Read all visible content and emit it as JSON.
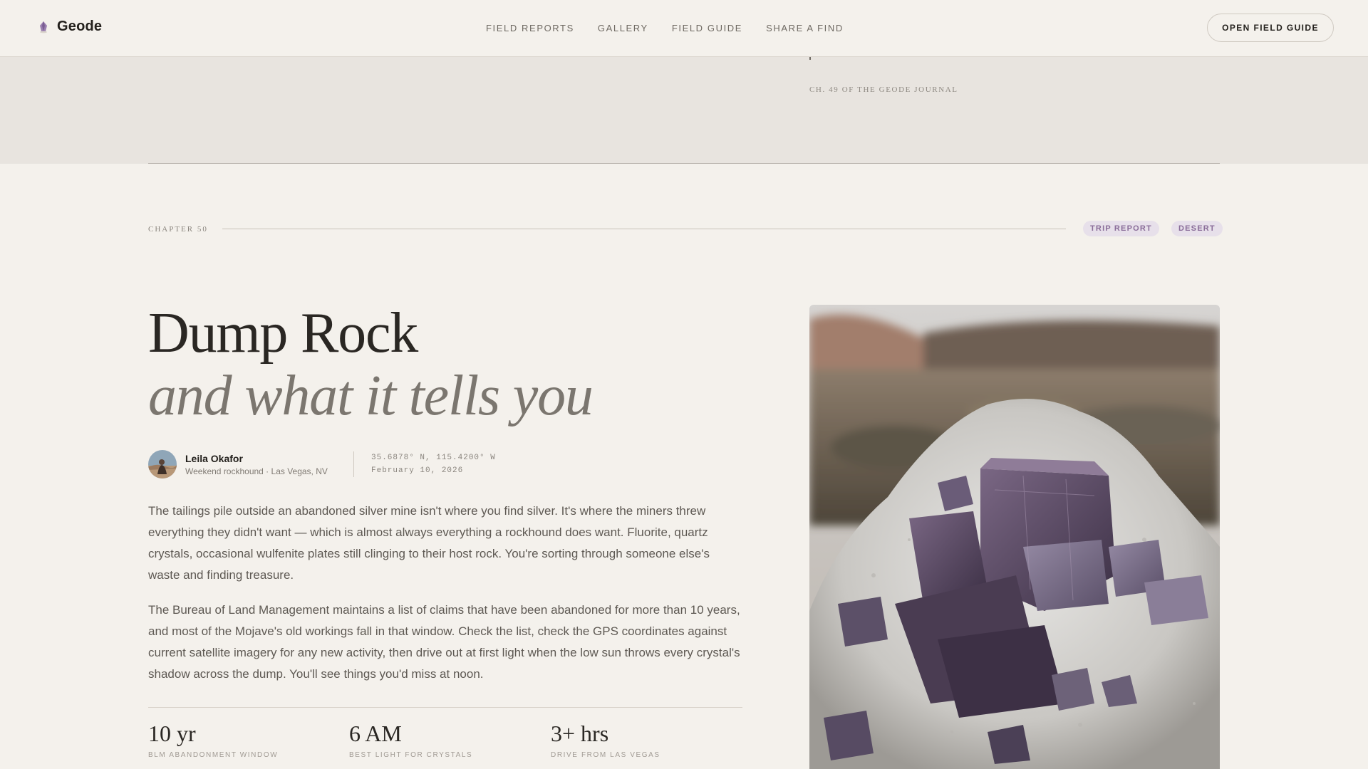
{
  "nav": {
    "brand": "Geode",
    "links": [
      "FIELD REPORTS",
      "GALLERY",
      "FIELD GUIDE",
      "SHARE A FIND"
    ],
    "cta": "OPEN FIELD GUIDE"
  },
  "previous": {
    "note": "CH. 49 OF THE GEODE JOURNAL"
  },
  "chapter": {
    "label": "CHAPTER 50",
    "tags": [
      "TRIP REPORT",
      "DESERT"
    ]
  },
  "headline": {
    "title": "Dump Rock",
    "subtitle": "and what it tells you"
  },
  "byline": {
    "author": "Leila Okafor",
    "role": "Weekend rockhound · Las Vegas, NV",
    "coordinates": "35.6878° N, 115.4200° W",
    "date": "February 10, 2026"
  },
  "body": {
    "paragraphs": [
      "The tailings pile outside an abandoned silver mine isn't where you find silver. It's where the miners threw everything they didn't want — which is almost always everything a rockhound does want. Fluorite, quartz crystals, occasional wulfenite plates still clinging to their host rock. You're sorting through someone else's waste and finding treasure.",
      "The Bureau of Land Management maintains a list of claims that have been abandoned for more than 10 years, and most of the Mojave's old workings fall in that window. Check the list, check the GPS coordinates against current satellite imagery for any new activity, then drive out at first light when the low sun throws every crystal's shadow across the dump. You'll see things you'd miss at noon."
    ]
  },
  "stats": [
    {
      "value": "10 yr",
      "label": "BLM ABANDONMENT WINDOW"
    },
    {
      "value": "6 AM",
      "label": "BEST LIGHT FOR CRYSTALS"
    },
    {
      "value": "3+ hrs",
      "label": "DRIVE FROM LAS VEGAS"
    }
  ],
  "icons": {
    "brand": "geode-crystal-icon"
  },
  "colors": {
    "background": "#f4f1ec",
    "band": "#e8e4df",
    "accent": "#8a6d99",
    "tag_bg": "#e7e0ea"
  }
}
